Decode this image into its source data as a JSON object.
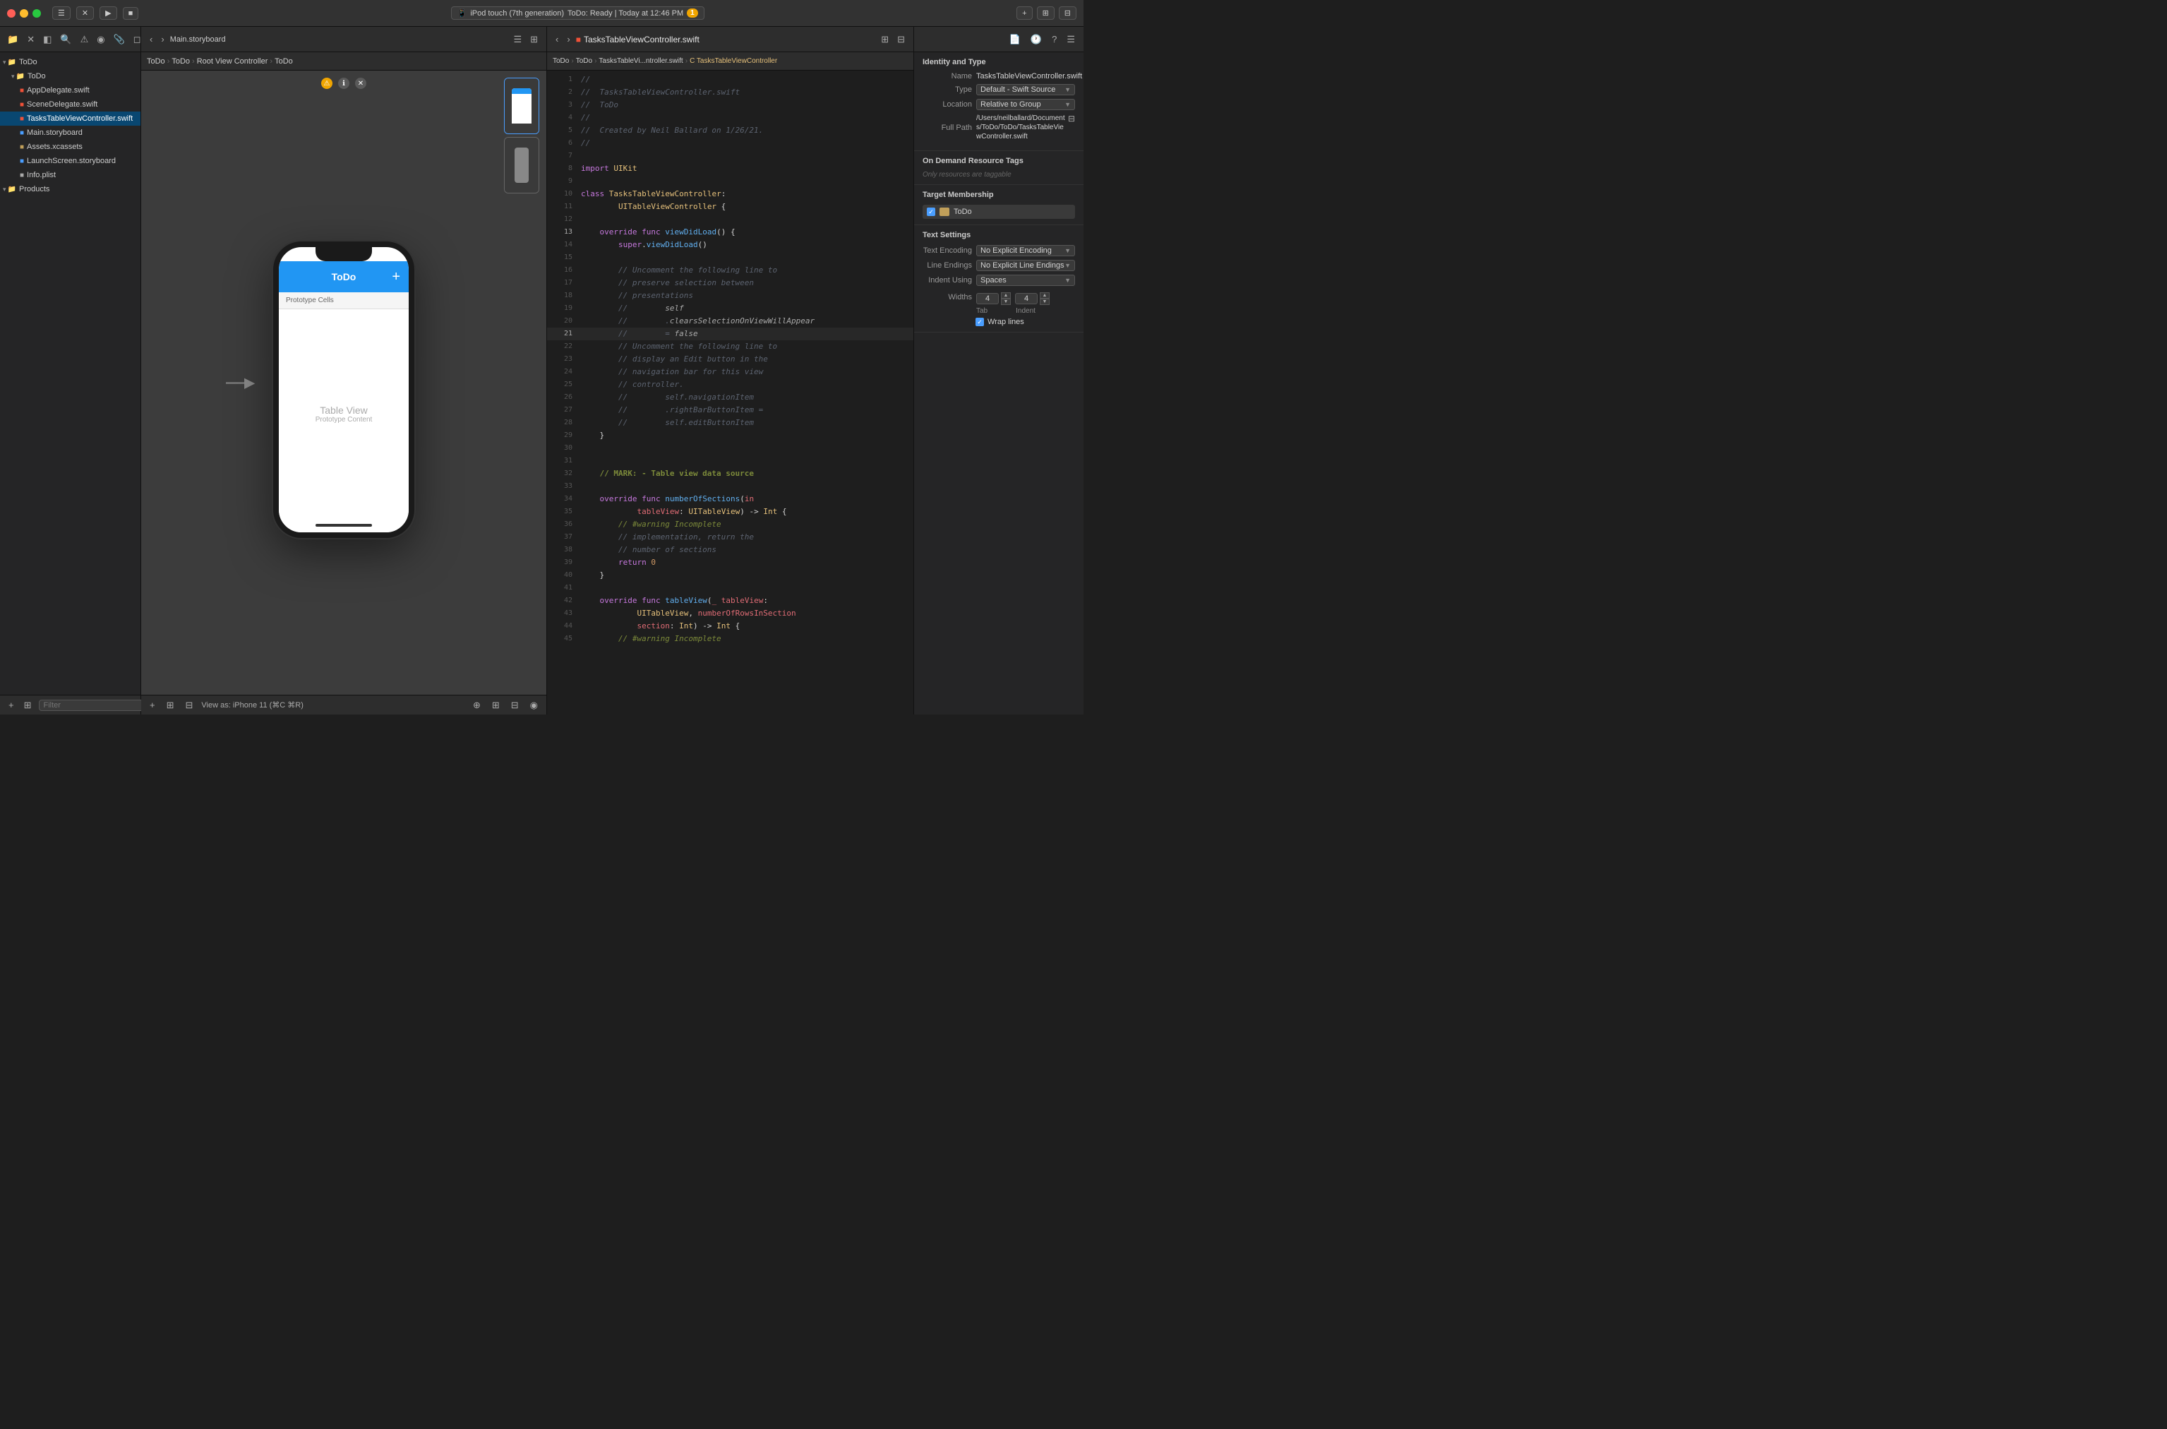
{
  "titlebar": {
    "title": "ToDo",
    "device": "iPod touch (7th generation)",
    "status": "ToDo: Ready | Today at 12:46 PM",
    "warning_count": "1",
    "run_btn": "▶",
    "stop_btn": "■"
  },
  "left_panel": {
    "toolbar_icons": [
      "☰",
      "✕",
      "◧",
      "🔍",
      "⚠",
      "◉",
      "📎",
      "◻",
      "➤"
    ],
    "tree": [
      {
        "level": 0,
        "icon": "▾",
        "type": "folder",
        "name": "ToDo",
        "expanded": true
      },
      {
        "level": 1,
        "icon": "▾",
        "type": "folder",
        "name": "ToDo",
        "expanded": true
      },
      {
        "level": 2,
        "icon": "",
        "type": "swift",
        "name": "AppDelegate.swift"
      },
      {
        "level": 2,
        "icon": "",
        "type": "swift",
        "name": "SceneDelegate.swift"
      },
      {
        "level": 2,
        "icon": "",
        "type": "swift",
        "name": "TasksTableViewController.swift",
        "active": true
      },
      {
        "level": 2,
        "icon": "",
        "type": "storyboard",
        "name": "Main.storyboard"
      },
      {
        "level": 2,
        "icon": "",
        "type": "xcassets",
        "name": "Assets.xcassets"
      },
      {
        "level": 2,
        "icon": "",
        "type": "storyboard",
        "name": "LaunchScreen.storyboard"
      },
      {
        "level": 2,
        "icon": "",
        "type": "plist",
        "name": "Info.plist"
      },
      {
        "level": 0,
        "icon": "▾",
        "type": "folder",
        "name": "Products",
        "expanded": true
      }
    ],
    "filter_placeholder": "Filter"
  },
  "middle_panel": {
    "breadcrumb": [
      "ToDo",
      ">",
      "ToDo",
      ">",
      "Root View Controller",
      ">",
      "ToDo"
    ],
    "iphone": {
      "nav_title": "ToDo",
      "nav_add": "+",
      "proto_cells": "Prototype Cells",
      "table_label": "Table View",
      "proto_label": "Prototype Content"
    },
    "bottom_bar": "View as: iPhone 11 (⌘C ⌘R)"
  },
  "code_panel": {
    "filename": "TasksTableViewController.swift",
    "breadcrumb": [
      "ToDo",
      ">",
      "ToDo",
      ">",
      "TasksTableVi...ntroller.swift",
      ">",
      "C TasksTableViewController"
    ],
    "lines": [
      {
        "n": 1,
        "code": "//"
      },
      {
        "n": 2,
        "code": "//  TasksTableViewController.swift"
      },
      {
        "n": 3,
        "code": "//  ToDo"
      },
      {
        "n": 4,
        "code": "//"
      },
      {
        "n": 5,
        "code": "//  Created by Neil Ballard on 1/26/21."
      },
      {
        "n": 6,
        "code": "//"
      },
      {
        "n": 7,
        "code": ""
      },
      {
        "n": 8,
        "code": "import UIKit"
      },
      {
        "n": 9,
        "code": ""
      },
      {
        "n": 10,
        "code": "class TasksTableViewController:"
      },
      {
        "n": 11,
        "code": "        UITableViewController {"
      },
      {
        "n": 12,
        "code": ""
      },
      {
        "n": 13,
        "code": "    override func viewDidLoad() {"
      },
      {
        "n": 14,
        "code": "        super.viewDidLoad()"
      },
      {
        "n": 15,
        "code": ""
      },
      {
        "n": 16,
        "code": "        // Uncomment the following line to"
      },
      {
        "n": 17,
        "code": "        // preserve selection between"
      },
      {
        "n": 18,
        "code": "        // presentations"
      },
      {
        "n": 19,
        "code": "        // self"
      },
      {
        "n": 20,
        "code": "        // .clearsSelectionOnViewWillAppear"
      },
      {
        "n": 21,
        "code": "        // = false"
      },
      {
        "n": 22,
        "code": "        //"
      },
      {
        "n": 23,
        "code": "        // Uncomment the following line to"
      },
      {
        "n": 24,
        "code": "        // display an Edit button in the"
      },
      {
        "n": 25,
        "code": "        // navigation bar for this view"
      },
      {
        "n": 26,
        "code": "        // controller."
      },
      {
        "n": 27,
        "code": "        // self.navigationItem"
      },
      {
        "n": 28,
        "code": "        // .rightBarButtonItem ="
      },
      {
        "n": 29,
        "code": "        // self.editButtonItem"
      },
      {
        "n": 30,
        "code": "    }"
      },
      {
        "n": 31,
        "code": ""
      },
      {
        "n": 32,
        "code": "    // MARK: - Table view data source"
      },
      {
        "n": 33,
        "code": ""
      },
      {
        "n": 34,
        "code": "    override func numberOfSections(in"
      },
      {
        "n": 35,
        "code": "            tableView: UITableView) -> Int {"
      },
      {
        "n": 36,
        "code": "        // #warning Incomplete"
      },
      {
        "n": 37,
        "code": "        // implementation, return the"
      },
      {
        "n": 38,
        "code": "        // number of sections"
      },
      {
        "n": 39,
        "code": "        return 0"
      },
      {
        "n": 40,
        "code": "    }"
      },
      {
        "n": 41,
        "code": ""
      },
      {
        "n": 42,
        "code": "    override func tableView(_ tableView:"
      },
      {
        "n": 43,
        "code": "            UITableView, numberOfRowsInSection"
      },
      {
        "n": 44,
        "code": "            section: Int) -> Int {"
      },
      {
        "n": 45,
        "code": "        // #warning Incomplete"
      }
    ]
  },
  "right_panel": {
    "section_identity": {
      "title": "Identity and Type",
      "name_label": "Name",
      "name_value": "TasksTableViewController.swift",
      "type_label": "Type",
      "type_value": "Default - Swift Source",
      "location_label": "Location",
      "location_value": "Relative to Group",
      "fullpath_label": "Full Path",
      "fullpath_value": "/Users/neilballard/Documents/ToDo/ToDo/TasksTableViewController.swift"
    },
    "section_demand": {
      "title": "On Demand Resource Tags",
      "placeholder": "Only resources are taggable"
    },
    "section_target": {
      "title": "Target Membership",
      "target": "ToDo"
    },
    "section_text": {
      "title": "Text Settings",
      "encoding_label": "Text Encoding",
      "encoding_value": "No Explicit Encoding",
      "line_endings_label": "Line Endings",
      "line_endings_value": "No Explicit Line Endings",
      "indent_label": "Indent Using",
      "indent_value": "Spaces",
      "widths_label": "Widths",
      "tab_value": "4",
      "indent_num_value": "4",
      "tab_label": "Tab",
      "indent_label2": "Indent",
      "wrap_label": "Wrap lines"
    }
  },
  "icons": {
    "chevron_right": "›",
    "chevron_down": "▾",
    "check": "✓",
    "plus": "+",
    "gear": "⚙",
    "warning": "⚠"
  }
}
